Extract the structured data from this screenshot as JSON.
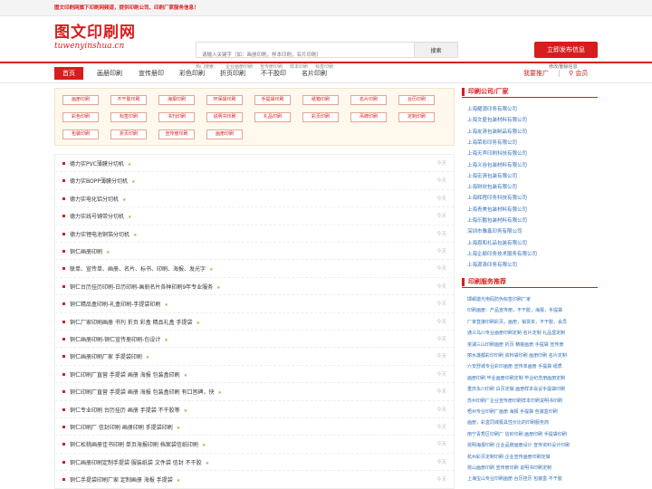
{
  "topbar": {
    "notice": "图文印刷网旗下印刷网频道，提供印刷公司、印刷厂家服务信息！"
  },
  "logo": {
    "cn": "图文印刷网",
    "en": "tuwenyinshua.cn"
  },
  "search": {
    "placeholder": "请输入关键字（如：画册印刷，样本印刷，名片印刷）",
    "button": "搜索"
  },
  "hotwords": {
    "label": "热门搜索：",
    "items": [
      "企业画册印刷",
      "宣传册印刷",
      "样本印刷",
      "标签印刷"
    ]
  },
  "publish": {
    "label": "立即发布信息",
    "note": "修改/删除信息"
  },
  "nav": {
    "items": [
      "首页",
      "画册印刷",
      "宣传册印",
      "彩色印刷",
      "折页印刷",
      "不干胶印",
      "名片印刷"
    ],
    "promote": "我要推广",
    "divider": "|",
    "join": "会员"
  },
  "tags": [
    "画册印刷",
    "不干胶印刷",
    "海报印刷",
    "环保袋印刷",
    "手提袋印刷",
    "纸箱印刷",
    "名片印刷",
    "台历印刷",
    "彩色印刷",
    "标签印刷",
    "书刊印刷",
    "说明书印刷",
    "礼品印刷",
    "彩页印刷",
    "吊牌印刷",
    "定制印刷",
    "包装印刷",
    "折页印刷",
    "宣传册印刷",
    "画册印刷"
  ],
  "list": [
    {
      "title": "德力实PVC薄膜分切机",
      "date": "今天"
    },
    {
      "title": "德力实BOPP薄膜分切机",
      "date": "今天"
    },
    {
      "title": "德力实电化铝分切机",
      "date": "今天"
    },
    {
      "title": "德力实线号铺带分切机",
      "date": "今天"
    },
    {
      "title": "德力实锂电池铜箔分切机",
      "date": "今天"
    },
    {
      "title": "铜仁画册印刷",
      "date": "今天"
    },
    {
      "title": "联单、宣传单、画册、名片、标书、印刷、海报、发光字",
      "date": "今天"
    },
    {
      "title": "铜仁台历挂历印刷-日历印刷-画册名片各种印刷9年专业服务",
      "date": "今天"
    },
    {
      "title": "铜仁精品盒印刷-礼盒印刷-手提袋印刷",
      "date": "今天"
    },
    {
      "title": "铜仁厂家印刷画册 书刊 折页 彩盒 精品礼盒 手提袋",
      "date": "今天"
    },
    {
      "title": "铜仁画册印刷-铜仁宣传册印刷-包设计",
      "date": "今天"
    },
    {
      "title": "铜仁画册印刷厂家 手提袋印刷",
      "date": "今天"
    },
    {
      "title": "铜仁印刷厂直营 手提袋 画册 海报 包装盒印刷",
      "date": "今天"
    },
    {
      "title": "铜仁印刷厂直营 手提袋 画册 海报 包装盒印刷 有口皆碑，快",
      "date": "今天"
    },
    {
      "title": "铜仁专业印刷 台历挂历 画册 手提袋 不干胶等",
      "date": "今天"
    },
    {
      "title": "铜仁印刷厂 信封印刷 画册印刷 手提袋印刷",
      "date": "今天"
    },
    {
      "title": "铜仁松桃画册佳书印刷 单页海报印刷 档案袋信纸印刷",
      "date": "今天"
    },
    {
      "title": "铜仁画册印刷定制手提袋 服装纸袋 文件袋 信封 不干胶",
      "date": "今天"
    },
    {
      "title": "铜仁手提袋印刷厂家 定制画册 海报 手提袋",
      "date": "今天"
    }
  ],
  "sidebar": {
    "companies_title": "印刷公司/厂家",
    "companies": [
      "上海耀源印务有限公司",
      "上海文盛包装材料有限公司",
      "上海友清包装制品有限公司",
      "上海荣彩印务有限公司",
      "上海天声印刷科技有限公司",
      "上海义谷包装材料有限公司",
      "上海宏清包装有限公司",
      "上海财欣包装有限公司",
      "上海辉程印务科技有限公司",
      "上海青美包装材料有限公司",
      "上海乐鹏包装材料有限公司",
      "深圳市雅鑫印务有限公司",
      "上海恩和礼品包装有限公司",
      "上海企颖印务技术服务有限公司",
      "上海源清印务有限公司"
    ],
    "services_title": "印刷服务推荐",
    "services": [
      "邯郸激光电码防伪标签印刷厂家",
      "印刷画册：产品宣传册，不干胶，海报，手提袋",
      "厂家直接印刷彩页，画册，销货单，不干胶，会员",
      "通义乌川专业画册印刷定制 名片定制 礼品盒定制",
      "芜湖三山印刷画册 折页 精装画册 手提袋 宣传册",
      "丽水莲都彩印印刷 资料袋印刷 画册印刷 名片定制",
      "六安舒城专业彩印画册 宣传单画册 手提袋 纸质",
      "画册印刷 毕业画册印刷定制 毕业纪念册画册定制",
      "重庆永川印刷 白页定做 画册样本会议手提袋印刷",
      "苏州印刷厂企业宣传册印刷样本印刷说明书印刷",
      "梧州专业印刷厂画册 海报 手提袋 包装盒印刷",
      "画册，彩盒同城极具性价比的印刷服务商",
      "南宁青秀区印刷厂 信封印刷 画册印刷 手提袋印刷",
      "昆明海报印刷 企业品牌画册设计 宣传资料设计印刷",
      "杭州彩页定制印刷 企业宣传画册印刷定做",
      "昆山画册印刷 宣传册印刷 说明书印刷定制",
      "上海宝山专业印刷画册 台历挂历 包装盒 不干胶"
    ]
  }
}
